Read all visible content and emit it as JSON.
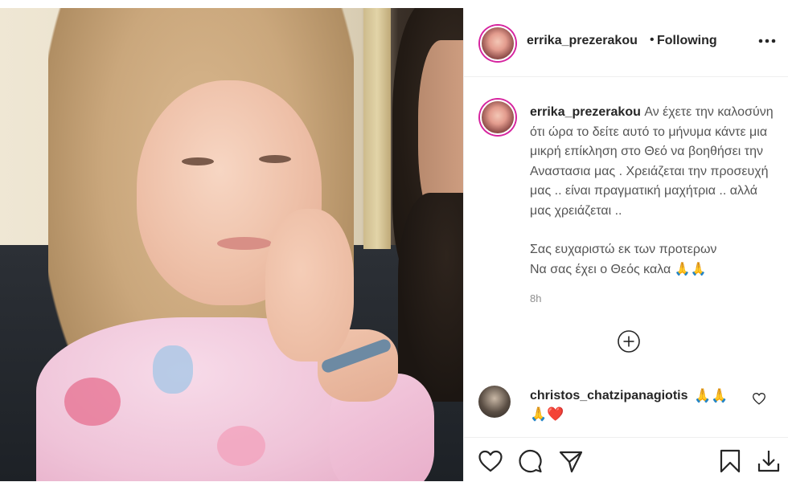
{
  "header": {
    "username": "errika_prezerakou",
    "separator": "•",
    "follow_status": "Following",
    "more_icon": "more-options-icon"
  },
  "caption": {
    "username": "errika_prezerakou",
    "paragraph1": "Αν έχετε την καλοσύνη ότι ώρα το δείτε αυτό το μήνυμα κάντε μια μικρή επίκληση στο Θεό να βοηθήσει την Αναστασια μας . Χρειάζεται την προσευχή μας .. είναι πραγματική μαχήτρια .. αλλά μας χρειάζεται ..",
    "paragraph2": "Σας ευχαριστώ εκ των προτερων",
    "paragraph3": "Να σας έχει ο Θεός καλα 🙏🙏",
    "time": "8h"
  },
  "comment": {
    "username": "christos_chatzipanagiotis",
    "emoji_line1": "🙏🙏",
    "emoji_line2": "🙏❤️"
  },
  "colors": {
    "text": "#262626",
    "muted": "#8e8e8e",
    "border": "#efefef",
    "heart": "#ed4956",
    "story_ring": "#d6249f"
  },
  "icons": [
    "more-options-icon",
    "load-more-plus-icon",
    "heart-icon",
    "comment-icon",
    "share-icon",
    "bookmark-icon",
    "download-icon"
  ]
}
